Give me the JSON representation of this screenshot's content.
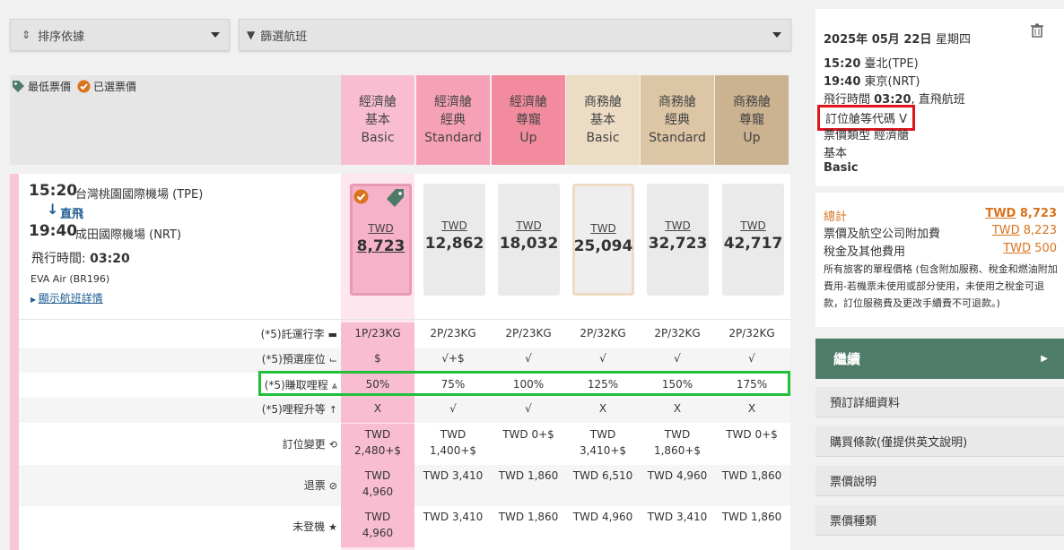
{
  "toolbar": {
    "sort_label": "排序依據",
    "filter_label": "篩選航班"
  },
  "legend": {
    "lowest": "最低票價",
    "selected": "已選票價"
  },
  "columns": [
    {
      "l1": "經濟艙",
      "l2": "基本",
      "l3": "Basic",
      "bg": "#f9bdd2"
    },
    {
      "l1": "經濟艙",
      "l2": "經典",
      "l3": "Standard",
      "bg": "#f7a1b6"
    },
    {
      "l1": "經濟艙",
      "l2": "尊寵",
      "l3": "Up",
      "bg": "#f28b9e"
    },
    {
      "l1": "商務艙",
      "l2": "基本",
      "l3": "Basic",
      "bg": "#ecdcc4"
    },
    {
      "l1": "商務艙",
      "l2": "經典",
      "l3": "Standard",
      "bg": "#dcc6a5"
    },
    {
      "l1": "商務艙",
      "l2": "尊寵",
      "l3": "Up",
      "bg": "#cbb290"
    }
  ],
  "flight": {
    "dep_time": "15:20",
    "dep_airport": "台灣桃園國際機場 (TPE)",
    "direct": "直飛",
    "arr_time": "19:40",
    "arr_airport": "成田國際機場 (NRT)",
    "duration_label": "飛行時間: ",
    "duration": "03:20",
    "carrier": "EVA Air (BR196)",
    "details_link": "顯示航班詳情"
  },
  "fares": [
    {
      "cur": "TWD",
      "amt": "8,723"
    },
    {
      "cur": "TWD",
      "amt": "12,862"
    },
    {
      "cur": "TWD",
      "amt": "18,032"
    },
    {
      "cur": "TWD",
      "amt": "25,094"
    },
    {
      "cur": "TWD",
      "amt": "32,723"
    },
    {
      "cur": "TWD",
      "amt": "42,717"
    }
  ],
  "rows": [
    {
      "label": "(*5)託運行李",
      "icon": "luggage-icon",
      "values": [
        "1P/23KG",
        "2P/23KG",
        "2P/23KG",
        "2P/32KG",
        "2P/32KG",
        "2P/32KG"
      ]
    },
    {
      "label": "(*5)預選座位",
      "icon": "seat-icon",
      "values": [
        "$",
        "√+$",
        "√",
        "√",
        "√",
        "√"
      ]
    },
    {
      "label": "(*5)賺取哩程",
      "icon": "mileage-icon",
      "values": [
        "50%",
        "75%",
        "100%",
        "125%",
        "150%",
        "175%"
      ]
    },
    {
      "label": "(*5)哩程升等",
      "icon": "upgrade-arrow-icon",
      "values": [
        "X",
        "√",
        "√",
        "X",
        "X",
        "X"
      ]
    },
    {
      "label": "訂位變更",
      "icon": "refresh-icon",
      "values": [
        "TWD\n2,480+$",
        "TWD\n1,400+$",
        "TWD 0+$",
        "TWD\n3,410+$",
        "TWD\n1,860+$",
        "TWD 0+$"
      ]
    },
    {
      "label": "退票",
      "icon": "refund-icon",
      "values": [
        "TWD\n4,960",
        "TWD 3,410",
        "TWD 1,860",
        "TWD 6,510",
        "TWD 4,960",
        "TWD 1,860"
      ]
    },
    {
      "label": "未登機",
      "icon": "star-icon",
      "values": [
        "TWD\n4,960",
        "TWD 3,410",
        "TWD 1,860",
        "TWD 4,960",
        "TWD 3,410",
        "TWD 1,860"
      ]
    }
  ],
  "summary": {
    "date_a": "2025年 05月 22日",
    "date_b": "星期四",
    "dep_time": "15:20",
    "dep_city": "臺北(TPE)",
    "arr_time": "19:40",
    "arr_city": "東京(NRT)",
    "duration_label": "飛行時間 ",
    "duration": "03:20",
    "duration_suffix": ", 直飛航班",
    "booking_class": "訂位艙等代碼 V",
    "fare_type": "票價類型 經濟艙",
    "fare_basic_zh": "基本",
    "fare_basic_en": "Basic",
    "total_label": "總計",
    "total_cur": "TWD",
    "total_amt": "8,723",
    "fare_label": "票價及航空公司附加費",
    "fare_cur": "TWD",
    "fare_amt": "8,223",
    "tax_label": "稅金及其他費用",
    "tax_cur": "TWD",
    "tax_amt": "500",
    "note": "所有旅客的單程價格 (包含附加服務、稅金和燃油附加費用-若機票未使用或部分使用，未使用之稅金可退款，訂位服務費及更改手續費不可退款。)",
    "continue": "繼續",
    "menu": [
      "預訂詳細資料",
      "購買條款(僅提供英文說明)",
      "票價說明",
      "票價種類"
    ]
  },
  "colors": {
    "accent_green": "#4e7c68",
    "total_orange": "#d9731c",
    "highlight_red": "#e0141b",
    "highlight_green": "#22c03a",
    "link_blue": "#1f5d93"
  }
}
